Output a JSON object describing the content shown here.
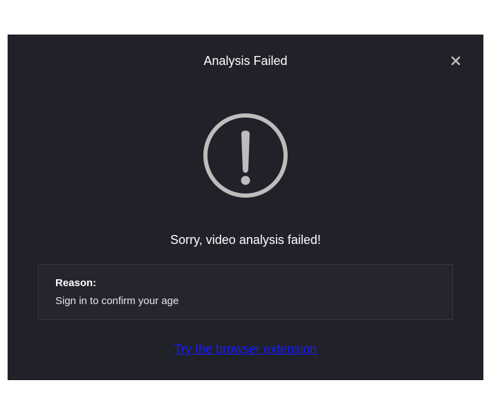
{
  "dialog": {
    "title": "Analysis Failed",
    "close_icon": "close-icon",
    "status_icon": "exclamation-circle-icon",
    "message": "Sorry, video analysis failed!",
    "reason_label": "Reason:",
    "reason_text": "Sign in to confirm your age",
    "link_text": "Try the browser extension"
  },
  "colors": {
    "dialog_background": "#21212a",
    "reason_box_background": "#25252e",
    "icon_gray": "#bdbdbd",
    "link_blue": "#1a1aff"
  }
}
